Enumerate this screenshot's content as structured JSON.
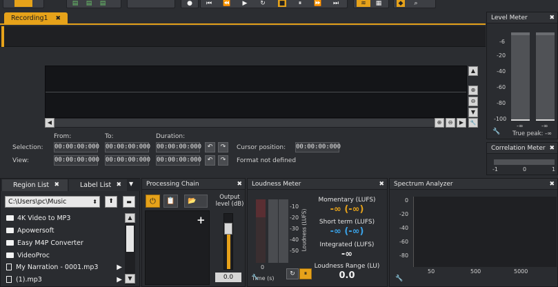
{
  "tabs": {
    "recording": "Recording1",
    "close": "✖"
  },
  "selection": {
    "from_label": "From:",
    "to_label": "To:",
    "duration_label": "Duration:",
    "selection_label": "Selection:",
    "view_label": "View:",
    "sel_from": "00:00:00:000",
    "sel_to": "00:00:00:000",
    "sel_duration": "00:00:00:000",
    "view_from": "00:00:00:000",
    "view_to": "00:00:00:000",
    "view_duration": "00:00:00:000",
    "cursor_label": "Cursor position:",
    "cursor_value": "00:00:00:000",
    "format_text": "Format not defined"
  },
  "level_meter": {
    "title": "Level Meter",
    "scale": [
      "-6",
      "-20",
      "-40",
      "-60",
      "-80",
      "-100"
    ],
    "left_peak": "-∞",
    "right_peak": "-∞",
    "true_peak": "True peak: -∞",
    "left_level_fraction": 0.0,
    "right_level_fraction": 0.0
  },
  "correlation": {
    "title": "Correlation Meter",
    "scale": [
      "-1",
      "0",
      "1"
    ]
  },
  "region_list": {
    "tab1": "Region List",
    "tab2": "Label List",
    "path": "C:\\Users\\pc\\Music",
    "items": [
      {
        "name": "4K Video to MP3",
        "type": "folder"
      },
      {
        "name": "Apowersoft",
        "type": "folder"
      },
      {
        "name": "Easy M4P Converter",
        "type": "folder"
      },
      {
        "name": "VideoProc",
        "type": "folder"
      },
      {
        "name": "My Narration - 0001.mp3",
        "type": "file"
      },
      {
        "name": "(1).mp3",
        "type": "file"
      }
    ]
  },
  "processing": {
    "title": "Processing Chain",
    "output_label": "Output level (dB)",
    "output_value": "0.0",
    "add": "+"
  },
  "loudness": {
    "title": "Loudness Meter",
    "scale": [
      "-10",
      "-20",
      "-30",
      "-40",
      "-50"
    ],
    "axis_label": "Loudness (LUFS)",
    "time_label": "Time (s)",
    "zero": "0",
    "momentary_label": "Momentary (LUFS)",
    "momentary_value": "-∞ (-∞)",
    "short_label": "Short term (LUFS)",
    "short_value": "-∞ (-∞)",
    "integrated_label": "Integrated (LUFS)",
    "integrated_value": "-∞",
    "range_label": "Loudness Range (LU)",
    "range_value": "0.0"
  },
  "spectrum": {
    "title": "Spectrum Analyzer",
    "y_scale": [
      "0",
      "-20",
      "-40",
      "-60",
      "-80"
    ],
    "x_scale": [
      "50",
      "500",
      "5000"
    ]
  },
  "icons": {
    "close": "✖",
    "up": "▲",
    "down": "▼",
    "left": "◀",
    "right": "▶",
    "zoom_in": "⊕",
    "zoom_out": "⊖",
    "wrench": "🔧",
    "undo": "↶",
    "redo": "↷",
    "power": "⏻",
    "folder_open": "📂",
    "clipboard": "📋",
    "pause": "⏸",
    "loop": "↻",
    "arrow_up": "⬆",
    "menu": "▼"
  },
  "colors": {
    "accent": "#e6a21a",
    "blue": "#3aa3e8",
    "bg": "#2a2c30"
  }
}
